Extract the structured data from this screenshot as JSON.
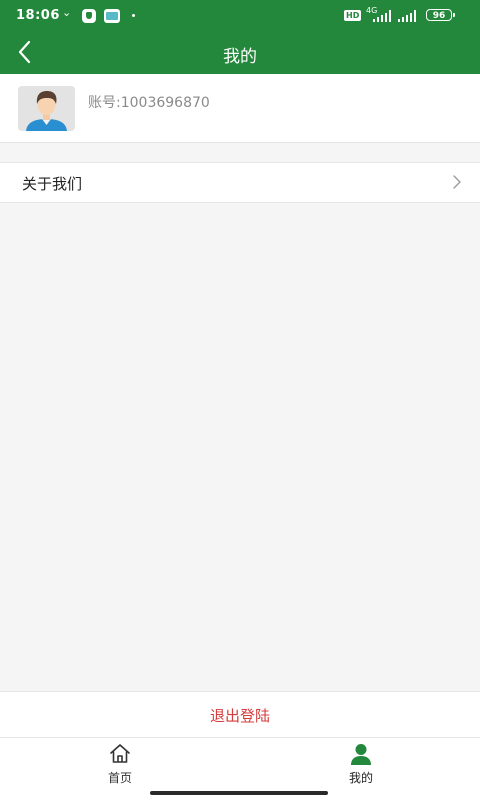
{
  "status_bar": {
    "time": "18:06",
    "network": "4G",
    "hd": "HD",
    "battery": "96"
  },
  "header": {
    "title": "我的",
    "back_icon": "chevron-left-icon"
  },
  "profile": {
    "account_label": "账号:1003696870",
    "avatar_icon": "user-avatar"
  },
  "menu": {
    "items": [
      {
        "label": "关于我们",
        "icon": "chevron-right-icon"
      }
    ]
  },
  "logout": {
    "label": "退出登陆"
  },
  "tabbar": {
    "tabs": [
      {
        "label": "首页",
        "icon": "home-icon"
      },
      {
        "label": "我的",
        "icon": "user-icon"
      }
    ]
  },
  "colors": {
    "primary": "#23883c",
    "danger": "#d63c3c",
    "tab_inactive": "#333333",
    "background": "#f5f5f5"
  }
}
